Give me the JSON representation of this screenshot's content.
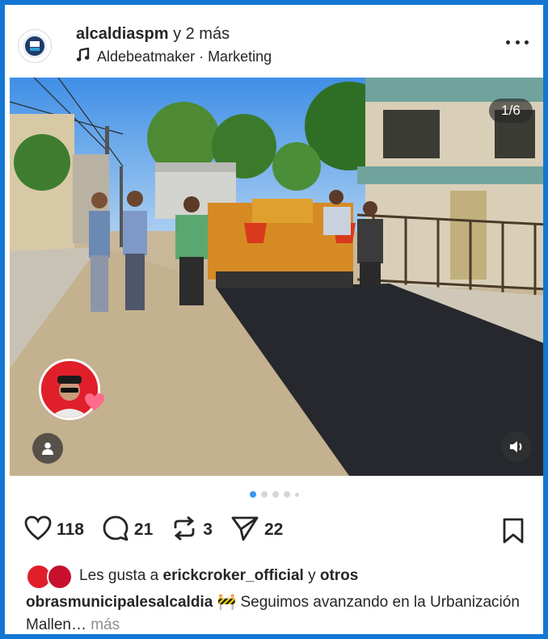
{
  "post": {
    "author": "alcaldiaspm",
    "author_suffix": " y 2 más",
    "audio": "Aldebeatmaker · Marketing",
    "media_counter": "1/6",
    "likes_count": "118",
    "comments_count": "21",
    "reposts_count": "3",
    "shares_count": "22",
    "liked_by_prefix": "Les gusta a ",
    "liked_by_user": "erickcroker_official",
    "liked_by_join": " y ",
    "liked_by_suffix": "otros",
    "caption_user": "obrasmunicipalesalcaldia",
    "caption_emoji": "🚧",
    "caption_text": " Seguimos avanzando en la Urbanización Mallen…",
    "caption_more": " más"
  },
  "carousel": {
    "total": 6,
    "current": 1
  },
  "icons": {
    "more": "more-options-icon",
    "music": "music-note-icon",
    "like": "heart-icon",
    "comment": "comment-bubble-icon",
    "repost": "repost-icon",
    "share": "send-icon",
    "save": "bookmark-icon",
    "tagged": "user-tag-icon",
    "sound": "volume-icon"
  },
  "colors": {
    "frame_border": "#1477d4",
    "accent": "#3897f0",
    "text": "#262626",
    "muted": "#8e8e8e"
  }
}
